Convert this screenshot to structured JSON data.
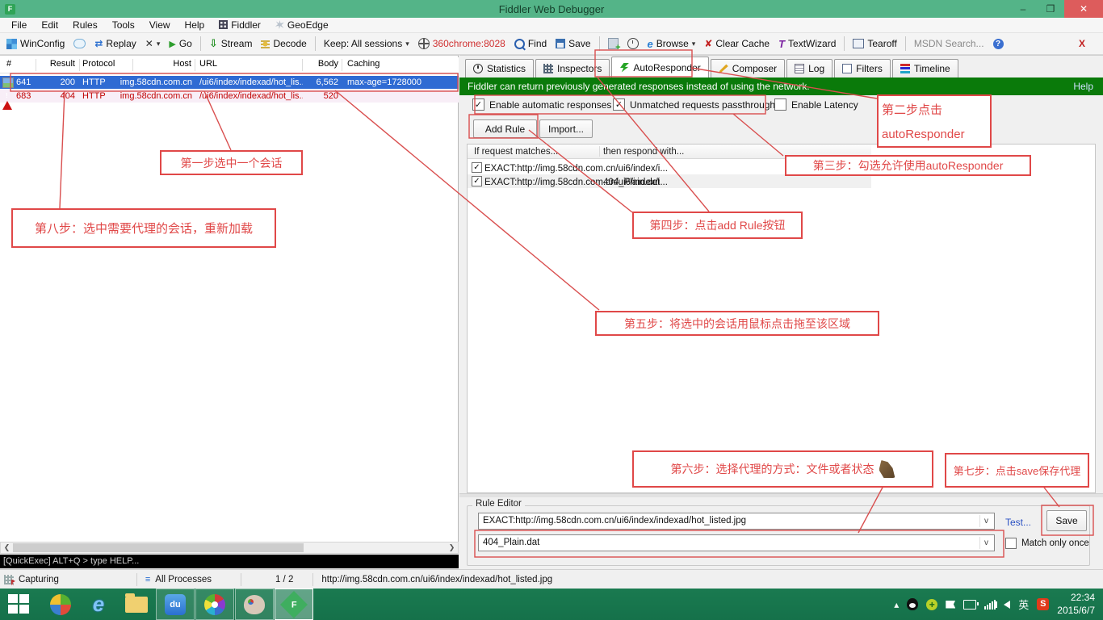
{
  "window": {
    "title": "Fiddler Web Debugger"
  },
  "menu": {
    "items": [
      "File",
      "Edit",
      "Rules",
      "Tools",
      "View",
      "Help",
      "Fiddler",
      "GeoEdge"
    ]
  },
  "toolbar": {
    "winconfig": "WinConfig",
    "replay": "Replay",
    "go": "Go",
    "stream": "Stream",
    "decode": "Decode",
    "keep_label": "Keep: All sessions",
    "proxy_label": "360chrome:8028",
    "find": "Find",
    "save": "Save",
    "browse": "Browse",
    "clear_cache": "Clear Cache",
    "textwizard": "TextWizard",
    "tearoff": "Tearoff",
    "msdn_search": "MSDN Search..."
  },
  "session_list": {
    "columns": {
      "num": "#",
      "result": "Result",
      "protocol": "Protocol",
      "host": "Host",
      "url": "URL",
      "body": "Body",
      "caching": "Caching"
    },
    "rows": [
      {
        "num": "641",
        "result": "200",
        "protocol": "HTTP",
        "host": "img.58cdn.com.cn",
        "url": "/ui6/index/indexad/hot_lis...",
        "body": "6,562",
        "caching": "max-age=1728000"
      },
      {
        "num": "683",
        "result": "404",
        "protocol": "HTTP",
        "host": "img.58cdn.com.cn",
        "url": "/ui6/index/indexad/hot_lis...",
        "body": "520",
        "caching": ""
      }
    ]
  },
  "tabs": {
    "statistics": "Statistics",
    "inspectors": "Inspectors",
    "autoresponder": "AutoResponder",
    "composer": "Composer",
    "log": "Log",
    "filters": "Filters",
    "timeline": "Timeline"
  },
  "autoresponder": {
    "banner": "Fiddler can return previously generated responses instead of using the network.",
    "help": "Help",
    "enable_label": "Enable automatic responses",
    "unmatched_label": "Unmatched requests passthrough",
    "latency_label": "Enable Latency",
    "add_rule": "Add Rule",
    "import": "Import...",
    "col_match": "If request matches...",
    "col_respond": "then respond with...",
    "rules": [
      {
        "match": "EXACT:http://img.58cdn.com.cn/ui6/index/i...",
        "respond": ""
      },
      {
        "match": "EXACT:http://img.58cdn.com.cn/ui6/index/i...",
        "respond": "404_Plain.dat"
      }
    ],
    "rule_editor": {
      "label": "Rule Editor",
      "match_value": "EXACT:http://img.58cdn.com.cn/ui6/index/indexad/hot_listed.jpg",
      "respond_value": "404_Plain.dat",
      "test": "Test...",
      "save": "Save",
      "match_once": "Match only once"
    }
  },
  "quickexec": "[QuickExec] ALT+Q > type HELP...",
  "status": {
    "capturing": "Capturing",
    "processes": "All Processes",
    "count": "1 / 2",
    "url": "http://img.58cdn.com.cn/ui6/index/indexad/hot_listed.jpg"
  },
  "annotations": {
    "step1": "第一步选中一个会话",
    "step2_line1": "第二步点击",
    "step2_line2": "autoResponder",
    "step3": "第三步：勾选允许使用autoResponder",
    "step4": "第四步：点击add Rule按钮",
    "step5": "第五步：将选中的会话用鼠标点击拖至该区域",
    "step6": "第六步：选择代理的方式：文件或者状态",
    "step7": "第七步：点击save保存代理",
    "step8": "第八步：选中需要代理的会话，重新加载"
  },
  "taskbar": {
    "time": "22:34",
    "date": "2015/6/7",
    "ime": "英"
  }
}
